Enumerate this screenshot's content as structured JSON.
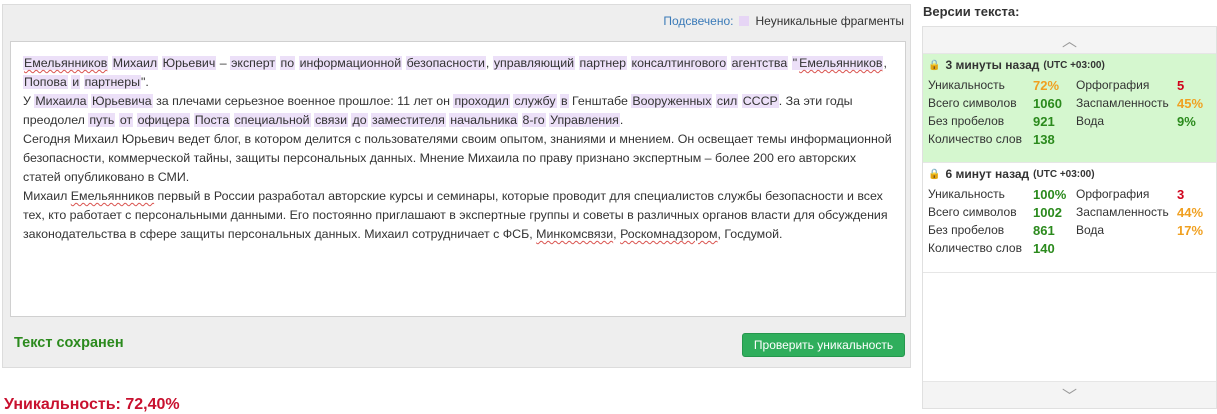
{
  "legend": {
    "label": "Подсвечено:",
    "text": "Неуникальные фрагменты"
  },
  "editor": {
    "p1": [
      {
        "t": "Емельянников",
        "h": 1,
        "s": 1
      },
      {
        "t": " "
      },
      {
        "t": "Михаил",
        "h": 1
      },
      {
        "t": " "
      },
      {
        "t": "Юрьевич",
        "h": 1
      },
      {
        "t": " – "
      },
      {
        "t": "эксперт",
        "h": 1
      },
      {
        "t": " "
      },
      {
        "t": "по",
        "h": 1
      },
      {
        "t": " "
      },
      {
        "t": "информационной",
        "h": 1
      },
      {
        "t": " "
      },
      {
        "t": "безопасности",
        "h": 1
      },
      {
        "t": ", "
      },
      {
        "t": "управляющий",
        "h": 1
      },
      {
        "t": " "
      },
      {
        "t": "партнер",
        "h": 1
      },
      {
        "t": " "
      },
      {
        "t": "консалтингового",
        "h": 1
      },
      {
        "t": " "
      },
      {
        "t": "агентства",
        "h": 1
      },
      {
        "t": " "
      },
      {
        "t": "\"",
        "h": 1
      },
      {
        "t": "Емельянников",
        "h": 1,
        "s": 1
      },
      {
        "t": ", "
      },
      {
        "t": "Попова",
        "h": 1
      },
      {
        "t": " "
      },
      {
        "t": "и",
        "h": 1
      },
      {
        "t": " "
      },
      {
        "t": "партнеры",
        "h": 1
      },
      {
        "t": "\"."
      }
    ],
    "p2": [
      {
        "t": "У "
      },
      {
        "t": "Михаила",
        "h": 1
      },
      {
        "t": " "
      },
      {
        "t": "Юрьевича",
        "h": 1
      },
      {
        "t": " за плечами серьезное военное прошлое: 11 лет он "
      },
      {
        "t": "проходил",
        "h": 1
      },
      {
        "t": " "
      },
      {
        "t": "службу",
        "h": 1
      },
      {
        "t": " "
      },
      {
        "t": "в",
        "h": 1
      },
      {
        "t": " Генштабе "
      },
      {
        "t": "Вооруженных",
        "h": 1
      },
      {
        "t": " "
      },
      {
        "t": "сил",
        "h": 1
      },
      {
        "t": " "
      },
      {
        "t": "СССР",
        "h": 1
      },
      {
        "t": ". За эти годы преодолел "
      },
      {
        "t": "путь",
        "h": 1
      },
      {
        "t": " "
      },
      {
        "t": "от",
        "h": 1
      },
      {
        "t": " "
      },
      {
        "t": "офицера",
        "h": 1
      },
      {
        "t": " "
      },
      {
        "t": "Поста",
        "h": 1
      },
      {
        "t": " "
      },
      {
        "t": "специальной",
        "h": 1
      },
      {
        "t": " "
      },
      {
        "t": "связи",
        "h": 1
      },
      {
        "t": " "
      },
      {
        "t": "до",
        "h": 1
      },
      {
        "t": " "
      },
      {
        "t": "заместителя",
        "h": 1
      },
      {
        "t": " "
      },
      {
        "t": "начальника",
        "h": 1
      },
      {
        "t": " "
      },
      {
        "t": "8-го",
        "h": 1
      },
      {
        "t": " "
      },
      {
        "t": "Управления",
        "h": 1
      },
      {
        "t": "."
      }
    ],
    "p3": [
      {
        "t": "Сегодня Михаил Юрьевич ведет блог, в котором делится с пользователями своим опытом, знаниями и мнением. Он освещает темы информационной безопасности, коммерческой тайны, защиты персональных данных. Мнение Михаила по праву признано экспертным – более 200 его авторских статей опубликовано в СМИ."
      }
    ],
    "p4": [
      {
        "t": "Михаил "
      },
      {
        "t": "Емельянников",
        "s": 1
      },
      {
        "t": " первый в России разработал авторские курсы и семинары, которые проводит для специалистов службы безопасности и всех тех, кто работает с персональными данными. Его постоянно приглашают в экспертные группы и советы в различных органов власти для обсуждения законодательства в сфере защиты персональных данных. Михаил сотрудничает с ФСБ, "
      },
      {
        "t": "Минкомсвязи",
        "s": 1
      },
      {
        "t": ", "
      },
      {
        "t": "Роскомнадзором",
        "s": 1
      },
      {
        "t": ", Госдумой."
      }
    ]
  },
  "status": {
    "saved": "Текст сохранен",
    "check_button": "Проверить уникальность",
    "uniqueness": "Уникальность: 72,40%"
  },
  "versions": {
    "title": "Версии текста:",
    "items": [
      {
        "time": "3 минуты назад",
        "tz": "(UTC +03:00)",
        "active": true,
        "unique_label": "Уникальность",
        "unique": "72%",
        "unique_color": "orange",
        "chars_label": "Всего символов",
        "chars": "1060",
        "nospace_label": "Без пробелов",
        "nospace": "921",
        "words_label": "Количество слов",
        "words": "138",
        "spell_label": "Орфография",
        "spell": "5",
        "spam_label": "Заспамленность",
        "spam": "45%",
        "water_label": "Вода",
        "water": "9%",
        "water_color": "green"
      },
      {
        "time": "6 минут назад",
        "tz": "(UTC +03:00)",
        "active": false,
        "unique_label": "Уникальность",
        "unique": "100%",
        "unique_color": "green",
        "chars_label": "Всего символов",
        "chars": "1002",
        "nospace_label": "Без пробелов",
        "nospace": "861",
        "words_label": "Количество слов",
        "words": "140",
        "spell_label": "Орфография",
        "spell": "3",
        "spam_label": "Заспамленность",
        "spam": "44%",
        "water_label": "Вода",
        "water": "17%",
        "water_color": "orange"
      }
    ]
  },
  "colors": {
    "highlight": "#ece0f8",
    "button": "#2fae5c",
    "saved": "#2b8a1d",
    "uniqueness": "#c8102e"
  }
}
